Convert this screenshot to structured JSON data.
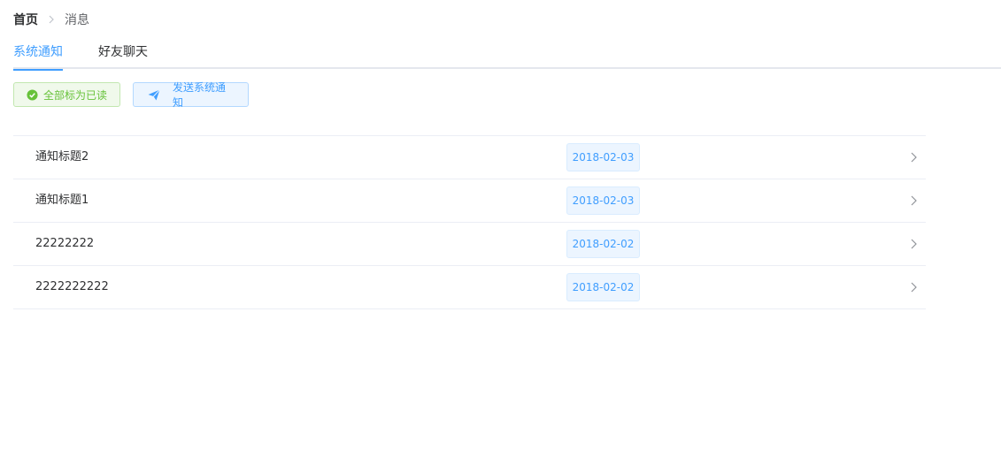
{
  "breadcrumb": {
    "home": "首页",
    "current": "消息",
    "separator_icon": "chevron-right-icon"
  },
  "tabs": [
    {
      "label": "系统通知",
      "active": true
    },
    {
      "label": "好友聊天",
      "active": false
    }
  ],
  "actions": {
    "mark_all_read": {
      "label": "全部标为已读",
      "icon": "check-circle-icon",
      "color": "#67c23a"
    },
    "send_notice": {
      "label": "发送系统通知",
      "icon": "paper-plane-icon",
      "color": "#409eff"
    }
  },
  "notifications": [
    {
      "title": "通知标题2",
      "date": "2018-02-03"
    },
    {
      "title": "通知标题1",
      "date": "2018-02-03"
    },
    {
      "title": "22222222",
      "date": "2018-02-02"
    },
    {
      "title": "2222222222",
      "date": "2018-02-02"
    }
  ],
  "colors": {
    "primary": "#409eff",
    "success": "#67c23a",
    "border": "#ebeef5"
  }
}
